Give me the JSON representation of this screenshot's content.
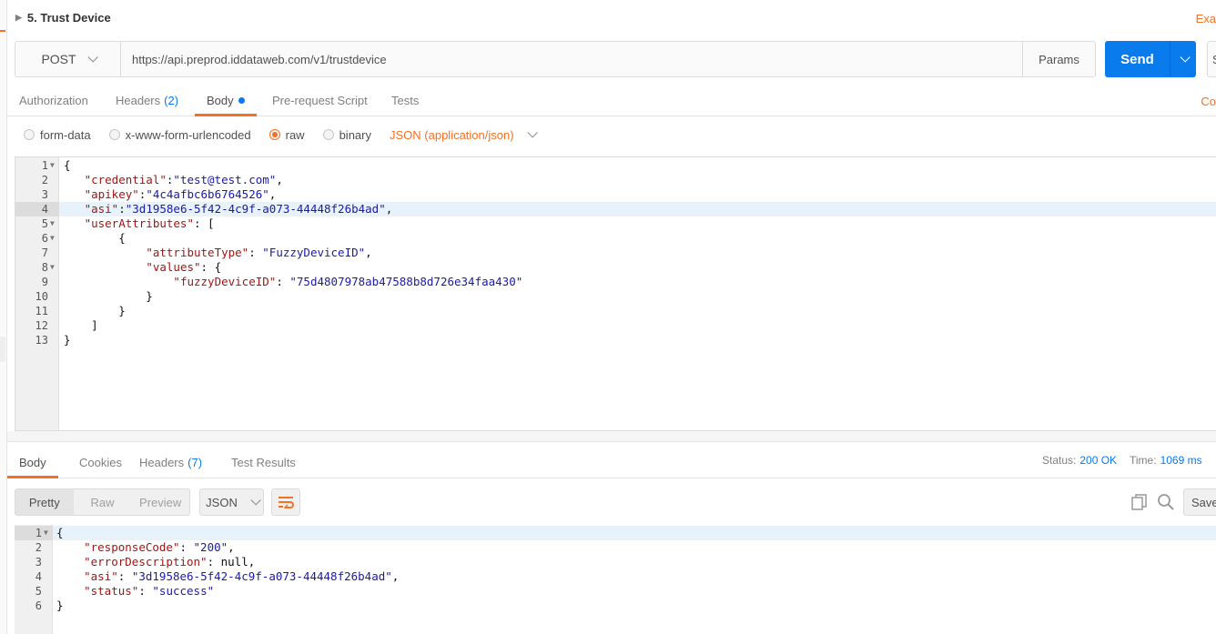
{
  "request": {
    "title": "5. Trust Device",
    "examples_link": "Exa",
    "method": "POST",
    "url": "https://api.preprod.iddataweb.com/v1/trustdevice",
    "params_label": "Params",
    "send_label": "Send",
    "save_label": "S",
    "cookies_link": "Co"
  },
  "request_tabs": [
    {
      "label": "Authorization"
    },
    {
      "label": "Headers",
      "count": "(2)"
    },
    {
      "label": "Body"
    },
    {
      "label": "Pre-request Script"
    },
    {
      "label": "Tests"
    }
  ],
  "body_types": [
    {
      "label": "form-data",
      "selected": false
    },
    {
      "label": "x-www-form-urlencoded",
      "selected": false
    },
    {
      "label": "raw",
      "selected": true
    },
    {
      "label": "binary",
      "selected": false
    }
  ],
  "content_type": "JSON (application/json)",
  "request_body_lines": [
    {
      "no": "1",
      "fold": true,
      "text": "{"
    },
    {
      "no": "2",
      "fold": false,
      "text": "   \"credential\":\"test@test.com\","
    },
    {
      "no": "3",
      "fold": false,
      "text": "   \"apikey\":\"4c4afbc6b6764526\","
    },
    {
      "no": "4",
      "fold": false,
      "text": "   \"asi\":\"3d1958e6-5f42-4c9f-a073-44448f26b4ad\","
    },
    {
      "no": "5",
      "fold": true,
      "text": "   \"userAttributes\": ["
    },
    {
      "no": "6",
      "fold": true,
      "text": "        {"
    },
    {
      "no": "7",
      "fold": false,
      "text": "            \"attributeType\": \"FuzzyDeviceID\","
    },
    {
      "no": "8",
      "fold": true,
      "text": "            \"values\": {"
    },
    {
      "no": "9",
      "fold": false,
      "text": "                \"fuzzyDeviceID\": \"75d4807978ab47588b8d726e34faa430\""
    },
    {
      "no": "10",
      "fold": false,
      "text": "            }"
    },
    {
      "no": "11",
      "fold": false,
      "text": "        }"
    },
    {
      "no": "12",
      "fold": false,
      "text": "    ]"
    },
    {
      "no": "13",
      "fold": false,
      "text": "}"
    }
  ],
  "response_tabs": [
    {
      "label": "Body"
    },
    {
      "label": "Cookies"
    },
    {
      "label": "Headers",
      "count": "(7)"
    },
    {
      "label": "Test Results"
    }
  ],
  "response_status": {
    "status_label": "Status:",
    "status_value": "200 OK",
    "time_label": "Time:",
    "time_value": "1069 ms"
  },
  "response_view_modes": [
    "Pretty",
    "Raw",
    "Preview"
  ],
  "response_format": "JSON",
  "response_save_label": "Save",
  "response_body_lines": [
    {
      "no": "1",
      "fold": true,
      "text": "{"
    },
    {
      "no": "2",
      "fold": false,
      "text": "    \"responseCode\": \"200\","
    },
    {
      "no": "3",
      "fold": false,
      "text": "    \"errorDescription\": null,"
    },
    {
      "no": "4",
      "fold": false,
      "text": "    \"asi\": \"3d1958e6-5f42-4c9f-a073-44448f26b4ad\","
    },
    {
      "no": "5",
      "fold": false,
      "text": "    \"status\": \"success\""
    },
    {
      "no": "6",
      "fold": false,
      "text": "}"
    }
  ],
  "colors": {
    "accent": "#f47023",
    "primary_blue": "#097bed",
    "json_key": "#a31515",
    "json_string": "#1a1aa6"
  }
}
